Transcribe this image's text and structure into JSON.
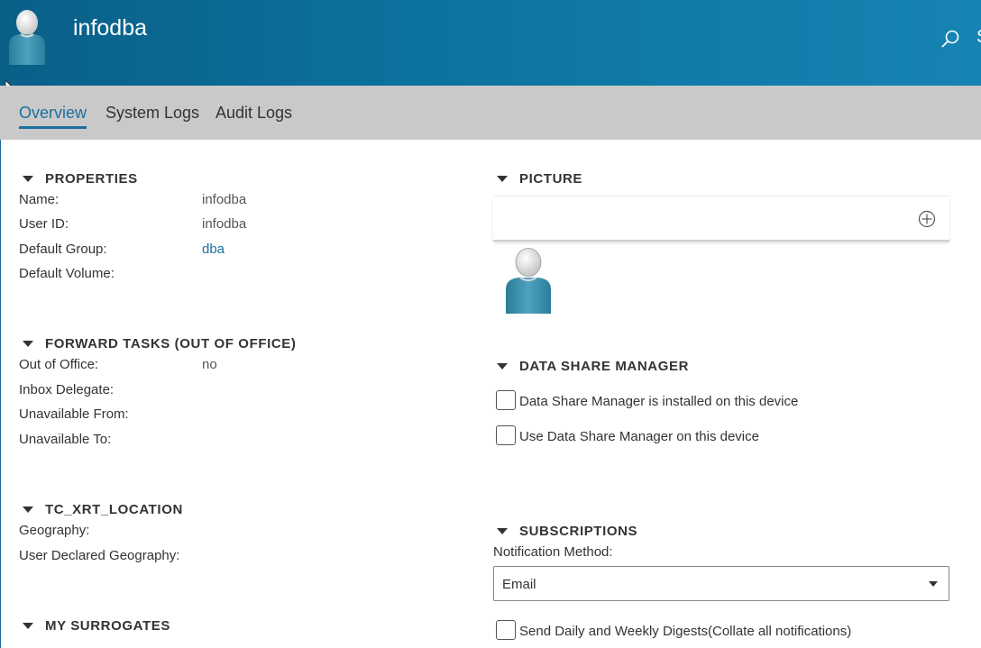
{
  "header": {
    "title": "infodba",
    "cut_glyph": "S"
  },
  "tabs": [
    {
      "label": "Overview",
      "active": true
    },
    {
      "label": "System Logs",
      "active": false
    },
    {
      "label": "Audit Logs",
      "active": false
    }
  ],
  "properties": {
    "heading": "PROPERTIES",
    "rows": [
      {
        "label": "Name:",
        "value": "infodba"
      },
      {
        "label": "User ID:",
        "value": "infodba"
      },
      {
        "label": "Default Group:",
        "value": "dba"
      },
      {
        "label": "Default Volume:",
        "value": ""
      }
    ]
  },
  "forward_tasks": {
    "heading": "FORWARD TASKS (OUT OF OFFICE)",
    "rows": [
      {
        "label": "Out of Office:",
        "value": "no"
      },
      {
        "label": "Inbox Delegate:",
        "value": ""
      },
      {
        "label": "Unavailable From:",
        "value": ""
      },
      {
        "label": "Unavailable To:",
        "value": ""
      }
    ]
  },
  "location": {
    "heading": "TC_XRT_LOCATION",
    "rows": [
      {
        "label": "Geography:"
      },
      {
        "label": "User Declared Geography:"
      }
    ]
  },
  "surrogates": {
    "heading": "MY SURROGATES"
  },
  "picture": {
    "heading": "PICTURE",
    "add_icon": "add-circle-icon"
  },
  "data_share": {
    "heading": "DATA SHARE MANAGER",
    "options": [
      {
        "label": "Data Share Manager is installed on this device",
        "checked": false
      },
      {
        "label": "Use Data Share Manager on this device",
        "checked": false
      }
    ]
  },
  "subscriptions": {
    "heading": "SUBSCRIPTIONS",
    "method_label": "Notification Method:",
    "method_value": "Email",
    "digest_label": "Send Daily and Weekly Digests(Collate all notifications)",
    "digest_checked": false
  },
  "colors": {
    "accent": "#1a6f9e",
    "header": "#0c73a0",
    "tabbar": "#c9c9c9"
  }
}
